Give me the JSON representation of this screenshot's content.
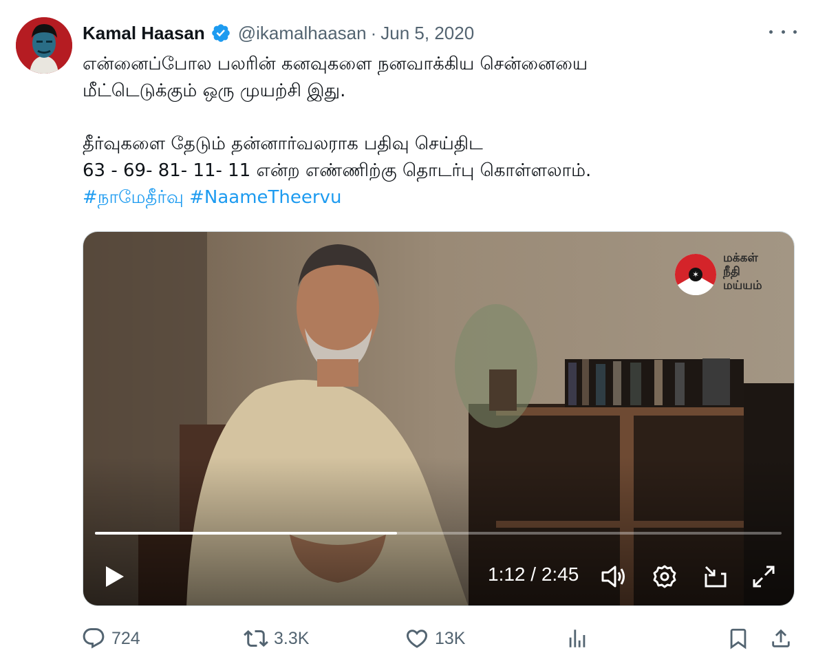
{
  "tweet": {
    "author_name": "Kamal Haasan",
    "handle": "@ikamalhaasan",
    "separator": "·",
    "date": "Jun 5, 2020",
    "verified": true,
    "text_lines": [
      "என்னைப்போல பலரின் கனவுகளை நனவாக்கிய சென்னையை",
      "மீட்டெடுக்கும் ஒரு முயற்சி இது.",
      "தீர்வுகளை தேடும் தன்னார்வலராக பதிவு செய்திட",
      "63 - 69- 81- 11- 11 என்ற எண்ணிற்கு தொடர்பு கொள்ளலாம்."
    ],
    "hashtags": [
      "#நாமேதீர்வு",
      "#NaameTheervu"
    ]
  },
  "video": {
    "watermark_lines": [
      "மக்கள்",
      "நீதி",
      "மய்யம்"
    ],
    "current_time": "1:12",
    "duration": "2:45",
    "time_display": "1:12 / 2:45",
    "progress_fraction": 0.44
  },
  "actions": {
    "replies": "724",
    "retweets": "3.3K",
    "likes": "13K"
  },
  "colors": {
    "accent": "#1d9bf0",
    "text": "#0f1419",
    "secondary": "#536471",
    "verified": "#1d9bf0"
  },
  "icons": [
    "more-icon",
    "verified-icon",
    "play-icon",
    "volume-icon",
    "settings-icon",
    "pip-icon",
    "fullscreen-icon",
    "reply-icon",
    "retweet-icon",
    "like-icon",
    "views-icon",
    "bookmark-icon",
    "share-icon"
  ]
}
